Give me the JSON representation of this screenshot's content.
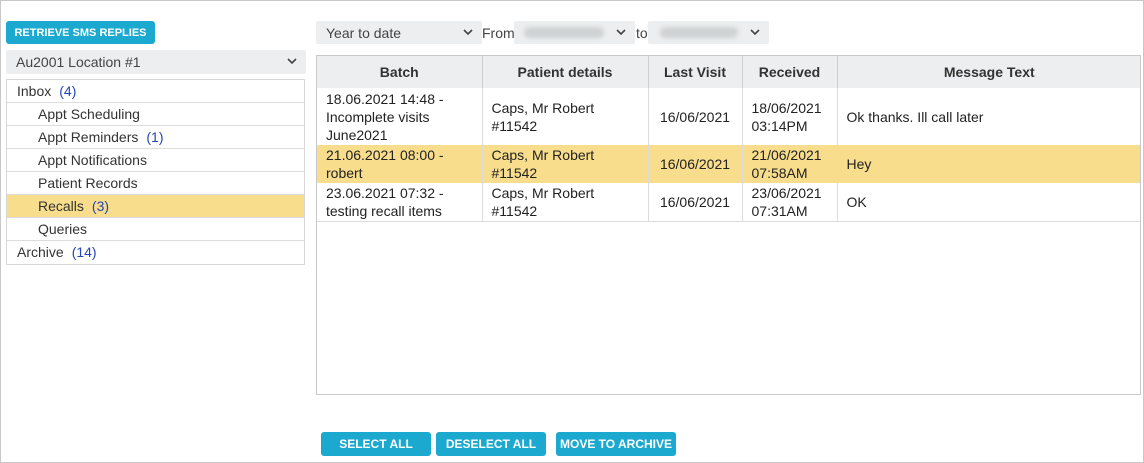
{
  "toolbar": {
    "retrieve_label": "RETRIEVE SMS REPLIES"
  },
  "location": {
    "selected": "Au2001 Location #1"
  },
  "folders": [
    {
      "label": "Inbox",
      "count": "(4)"
    },
    {
      "label": "Appt Scheduling",
      "count": ""
    },
    {
      "label": "Appt Reminders",
      "count": "(1)"
    },
    {
      "label": "Appt Notifications",
      "count": ""
    },
    {
      "label": "Patient Records",
      "count": ""
    },
    {
      "label": "Recalls",
      "count": "(3)"
    },
    {
      "label": "Queries",
      "count": ""
    },
    {
      "label": "Archive",
      "count": "(14)"
    }
  ],
  "filter": {
    "range_selected": "Year to date",
    "from_label": "From",
    "to_label": "to"
  },
  "table": {
    "headers": [
      "Batch",
      "Patient details",
      "Last Visit",
      "Received",
      "Message Text"
    ],
    "rows": [
      {
        "batch": "18.06.2021 14:48 - Incomplete visits June2021",
        "patient": "Caps, Mr Robert #11542",
        "last_visit": "16/06/2021",
        "received": "18/06/2021 03:14PM",
        "message": "Ok thanks. Ill call later"
      },
      {
        "batch": "21.06.2021 08:00 - robert",
        "patient": "Caps, Mr Robert #11542",
        "last_visit": "16/06/2021",
        "received": "21/06/2021 07:58AM",
        "message": "Hey"
      },
      {
        "batch": "23.06.2021 07:32 - testing recall items",
        "patient": "Caps, Mr Robert #11542",
        "last_visit": "16/06/2021",
        "received": "23/06/2021 07:31AM",
        "message": "OK"
      }
    ]
  },
  "actions": {
    "select_all": "SELECT ALL",
    "deselect_all": "DESELECT ALL",
    "move_to_archive": "MOVE TO ARCHIVE"
  },
  "colors": {
    "accent": "#1ba9cf",
    "highlight": "#f8dd8c",
    "count": "#2545b8"
  }
}
